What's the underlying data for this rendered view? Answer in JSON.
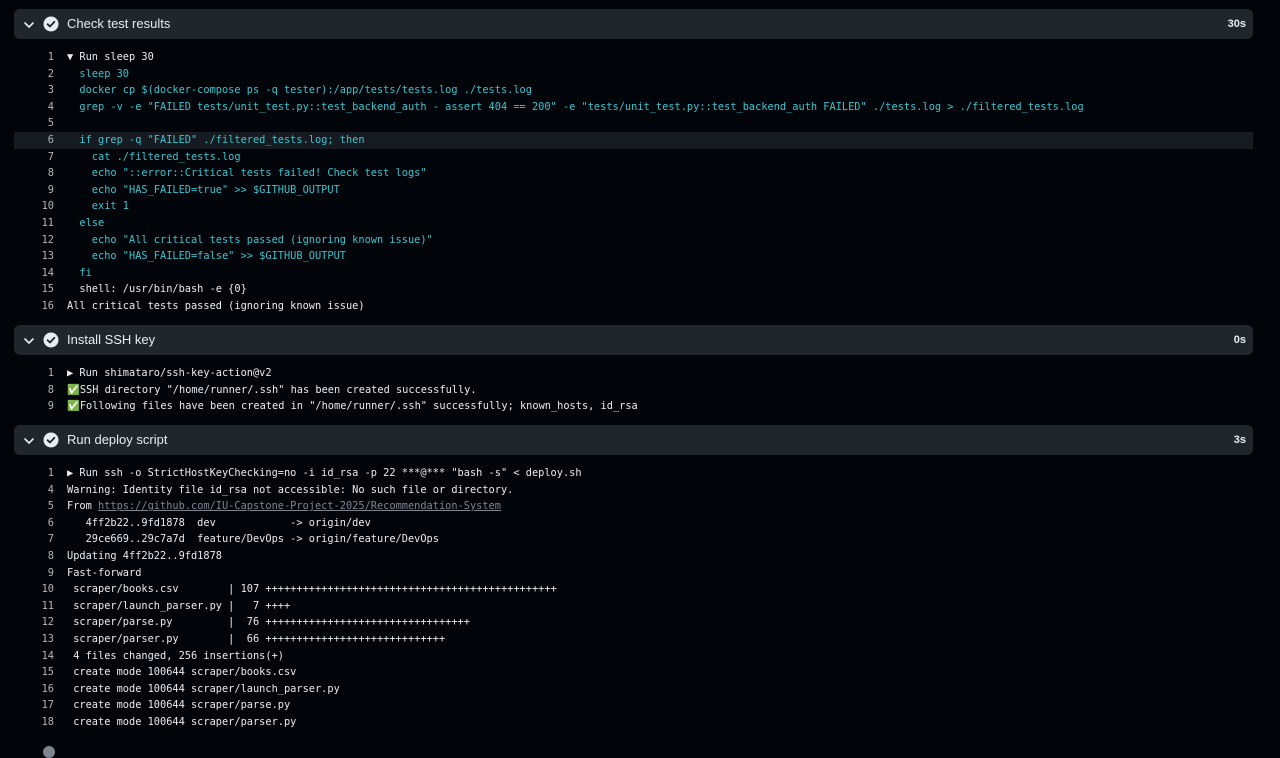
{
  "steps": [
    {
      "title": "Check test results",
      "duration": "30s",
      "lines": [
        {
          "n": "1",
          "text": "▼ Run sleep 30",
          "color": "white"
        },
        {
          "n": "2",
          "text": "  sleep 30",
          "color": "cyan"
        },
        {
          "n": "3",
          "text": "  docker cp $(docker-compose ps -q tester):/app/tests/tests.log ./tests.log",
          "color": "cyan"
        },
        {
          "n": "4",
          "text": "  grep -v -e \"FAILED tests/unit_test.py::test_backend_auth - assert 404 == 200\" -e \"tests/unit_test.py::test_backend_auth FAILED\" ./tests.log > ./filtered_tests.log",
          "color": "cyan"
        },
        {
          "n": "5",
          "text": "",
          "color": "cyan"
        },
        {
          "n": "6",
          "text": "  if grep -q \"FAILED\" ./filtered_tests.log; then",
          "color": "cyan",
          "highlight": true
        },
        {
          "n": "7",
          "text": "    cat ./filtered_tests.log",
          "color": "cyan"
        },
        {
          "n": "8",
          "text": "    echo \"::error::Critical tests failed! Check test logs\"",
          "color": "cyan"
        },
        {
          "n": "9",
          "text": "    echo \"HAS_FAILED=true\" >> $GITHUB_OUTPUT",
          "color": "cyan"
        },
        {
          "n": "10",
          "text": "    exit 1",
          "color": "cyan"
        },
        {
          "n": "11",
          "text": "  else",
          "color": "cyan"
        },
        {
          "n": "12",
          "text": "    echo \"All critical tests passed (ignoring known issue)\"",
          "color": "cyan"
        },
        {
          "n": "13",
          "text": "    echo \"HAS_FAILED=false\" >> $GITHUB_OUTPUT",
          "color": "cyan"
        },
        {
          "n": "14",
          "text": "  fi",
          "color": "cyan"
        },
        {
          "n": "15",
          "text": "  shell: /usr/bin/bash -e {0}",
          "color": "white"
        },
        {
          "n": "16",
          "text": "All critical tests passed (ignoring known issue)",
          "color": "white"
        }
      ]
    },
    {
      "title": "Install SSH key",
      "duration": "0s",
      "lines": [
        {
          "n": "1",
          "text": "▶ Run shimataro/ssh-key-action@v2",
          "color": "white"
        },
        {
          "n": "8",
          "text": "✅SSH directory \"/home/runner/.ssh\" has been created successfully.",
          "color": "white"
        },
        {
          "n": "9",
          "text": "✅Following files have been created in \"/home/runner/.ssh\" successfully; known_hosts, id_rsa",
          "color": "white"
        }
      ]
    },
    {
      "title": "Run deploy script",
      "duration": "3s",
      "lines": [
        {
          "n": "1",
          "text": "▶ Run ssh -o StrictHostKeyChecking=no -i id_rsa -p 22 ***@*** \"bash -s\" < deploy.sh",
          "color": "white"
        },
        {
          "n": "4",
          "text": "Warning: Identity file id_rsa not accessible: No such file or directory.",
          "color": "white"
        },
        {
          "n": "5",
          "text": "From ",
          "link": "https://github.com/IU-Capstone-Project-2025/Recommendation-System",
          "color": "white"
        },
        {
          "n": "6",
          "text": "   4ff2b22..9fd1878  dev            -> origin/dev",
          "color": "white"
        },
        {
          "n": "7",
          "text": "   29ce669..29c7a7d  feature/DevOps -> origin/feature/DevOps",
          "color": "white"
        },
        {
          "n": "8",
          "text": "Updating 4ff2b22..9fd1878",
          "color": "white"
        },
        {
          "n": "9",
          "text": "Fast-forward",
          "color": "white"
        },
        {
          "n": "10",
          "text": " scraper/books.csv        | 107 +++++++++++++++++++++++++++++++++++++++++++++++",
          "color": "white"
        },
        {
          "n": "11",
          "text": " scraper/launch_parser.py |   7 ++++",
          "color": "white"
        },
        {
          "n": "12",
          "text": " scraper/parse.py         |  76 +++++++++++++++++++++++++++++++++",
          "color": "white"
        },
        {
          "n": "13",
          "text": " scraper/parser.py        |  66 +++++++++++++++++++++++++++++",
          "color": "white"
        },
        {
          "n": "14",
          "text": " 4 files changed, 256 insertions(+)",
          "color": "white"
        },
        {
          "n": "15",
          "text": " create mode 100644 scraper/books.csv",
          "color": "white"
        },
        {
          "n": "16",
          "text": " create mode 100644 scraper/launch_parser.py",
          "color": "white"
        },
        {
          "n": "17",
          "text": " create mode 100644 scraper/parse.py",
          "color": "white"
        },
        {
          "n": "18",
          "text": " create mode 100644 scraper/parser.py",
          "color": "white"
        }
      ]
    }
  ],
  "colors": {
    "background": "#010409",
    "header_bg": "#21262d",
    "code_cyan": "#39c5cf",
    "text": "#e6edf3",
    "line_number": "#b0b7bf"
  },
  "icons": {
    "collapse": "chevron-down-icon",
    "status": "check-circle-icon"
  }
}
